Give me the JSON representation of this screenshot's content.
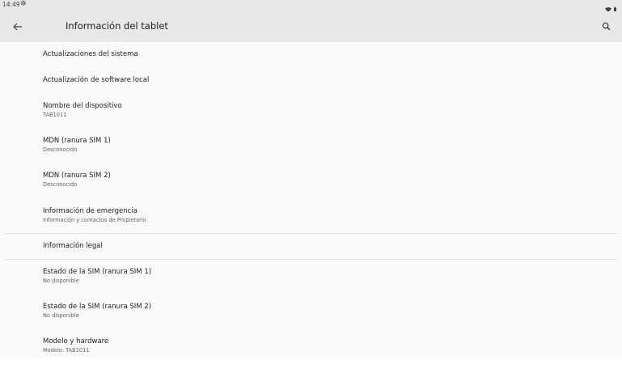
{
  "status_bar": {
    "time": "14:49",
    "left_icon": "gear-icon",
    "right_icons": [
      "wifi-icon",
      "battery-icon"
    ]
  },
  "app_bar": {
    "title": "Información del tablet",
    "back_icon": "arrow-left-icon",
    "search_icon": "search-icon"
  },
  "items": [
    {
      "title": "Actualizaciones del sistema",
      "subtitle": ""
    },
    {
      "title": "Actualización de software local",
      "subtitle": ""
    },
    {
      "title": "Nombre del dispositivo",
      "subtitle": "TAB1011"
    },
    {
      "title": "MDN (ranura SIM 1)",
      "subtitle": "Desconocido"
    },
    {
      "title": "MDN (ranura SIM 2)",
      "subtitle": "Desconocido"
    },
    {
      "title": "Información de emergencia",
      "subtitle": "Información y contactos de Propietario"
    },
    {
      "title": "Información legal",
      "subtitle": ""
    },
    {
      "title": "Estado de la SIM (ranura SIM 1)",
      "subtitle": "No disponible"
    },
    {
      "title": "Estado de la SIM (ranura SIM 2)",
      "subtitle": "No disponible"
    },
    {
      "title": "Modelo y hardware",
      "subtitle": "Modelo: TAB1011"
    }
  ],
  "nav_bar": {
    "buttons": [
      "back-nav-icon",
      "home-nav-icon",
      "recents-nav-icon"
    ]
  },
  "colors": {
    "app_bar_bg": "#e8e8e8",
    "content_bg": "#fafafa",
    "title_text": "#202124",
    "secondary_text": "#5f6368",
    "divider": "#e3e3e3"
  }
}
